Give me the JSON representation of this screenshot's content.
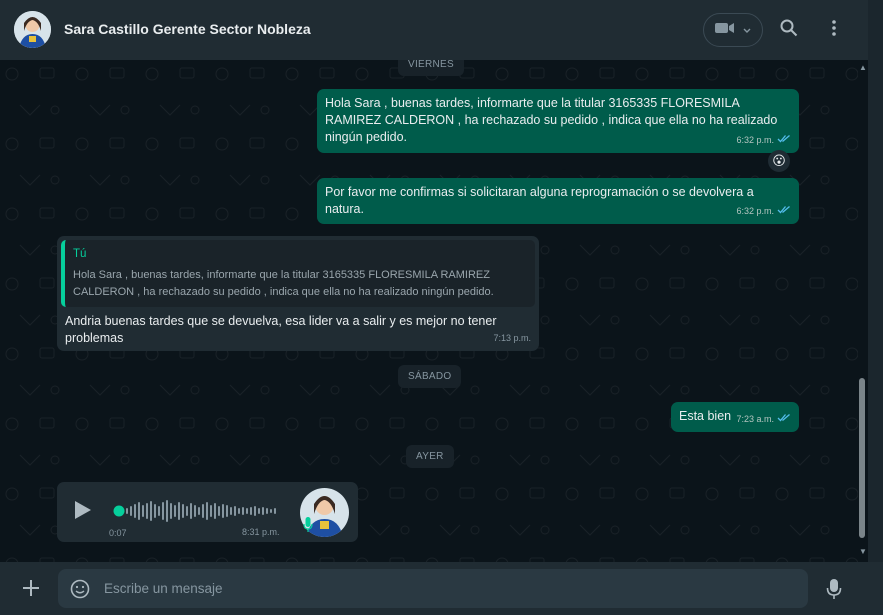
{
  "header": {
    "contact_name": "Sara Castillo Gerente Sector Nobleza"
  },
  "dates": {
    "viernes": "VIERNES",
    "sabado": "SÁBADO",
    "ayer": "AYER"
  },
  "messages": [
    {
      "direction": "out",
      "text": "Hola Sara , buenas tardes, informarte que la titular 3165335 FLORESMILA RAMIREZ CALDERON , ha rechazado su pedido , indica que ella no ha realizado ningún pedido.",
      "time": "6:32 p.m.",
      "reaction": "😮"
    },
    {
      "direction": "out",
      "text": "Por favor me confirmas si solicitaran alguna reprogramación o se devolvera a natura.",
      "time": "6:32 p.m."
    },
    {
      "direction": "in",
      "quote_author": "Tú",
      "quote_text": "Hola Sara , buenas tardes, informarte que la titular 3165335 FLORESMILA RAMIREZ CALDERON , ha rechazado su pedido , indica que ella no ha realizado ningún pedido.",
      "text": "Andria buenas tardes que se devuelva, esa lider va a salir y es mejor no tener problemas",
      "time": "7:13 p.m."
    },
    {
      "direction": "out",
      "text": "Esta bien",
      "time": "7:23 a.m."
    }
  ],
  "voice_note": {
    "duration": "0:07",
    "time": "8:31 p.m.",
    "progress": 0.0
  },
  "composer": {
    "placeholder": "Escribe un mensaje"
  },
  "icons": {
    "video": "video-camera-icon",
    "search": "search-icon",
    "menu": "kebab-menu-icon",
    "attach": "plus-icon",
    "emoji": "sticker-icon",
    "mic": "microphone-icon",
    "play": "play-icon"
  },
  "colors": {
    "outgoing_bubble": "#005c4b",
    "incoming_bubble": "#202c33",
    "accent": "#06cf9c",
    "read_ticks": "#53bdeb"
  }
}
